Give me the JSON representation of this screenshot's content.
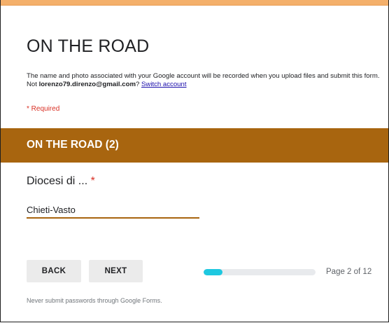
{
  "form": {
    "title": "ON THE ROAD",
    "notice_prefix": "The name and photo associated with your Google account will be recorded when you upload files and submit this form. Not ",
    "account_email": "lorenzo79.direnzo@gmail.com",
    "notice_suffix": "? ",
    "switch_account_label": "Switch account",
    "required_label": "* Required"
  },
  "section": {
    "title": "ON THE ROAD (2)"
  },
  "question": {
    "label": "Diocesi di ...",
    "required_marker": "*",
    "answer_value": "Chieti-Vasto"
  },
  "navigation": {
    "back_label": "BACK",
    "next_label": "NEXT",
    "page_label": "Page 2 of 12",
    "progress_fraction": 0.17
  },
  "footer": {
    "note": "Never submit passwords through Google Forms."
  },
  "colors": {
    "accent": "#a8650f",
    "progress": "#1ec8e0",
    "required": "#d93025",
    "link": "#1a0dab"
  }
}
